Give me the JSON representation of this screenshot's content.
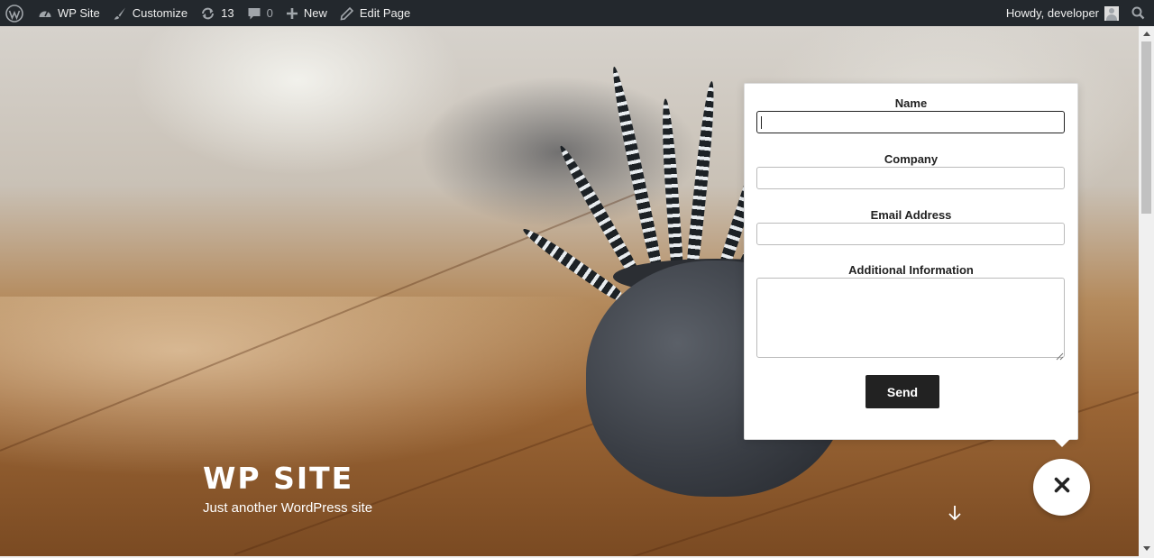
{
  "adminbar": {
    "site_name": "WP Site",
    "customize": "Customize",
    "updates_count": "13",
    "comments_count": "0",
    "new_label": "New",
    "edit_page": "Edit Page",
    "greeting": "Howdy, developer"
  },
  "hero": {
    "site_title": "WP SITE",
    "tagline": "Just another WordPress site"
  },
  "form": {
    "name_label": "Name",
    "name_value": "",
    "company_label": "Company",
    "company_value": "",
    "email_label": "Email Address",
    "email_value": "",
    "info_label": "Additional Information",
    "info_value": "",
    "send_label": "Send"
  },
  "icons": {
    "wp_logo": "wordpress-logo-icon",
    "dashboard": "dashboard-icon",
    "customize": "brush-icon",
    "updates": "updates-icon",
    "comments": "comment-icon",
    "new": "plus-icon",
    "edit": "pencil-icon",
    "avatar": "avatar-icon",
    "search": "search-icon",
    "scroll_down": "arrow-down-icon",
    "close": "close-icon"
  },
  "colors": {
    "adminbar_bg": "#23282d",
    "adminbar_text": "#eeeeee",
    "button_bg": "#222222",
    "popup_bg": "#ffffff"
  }
}
